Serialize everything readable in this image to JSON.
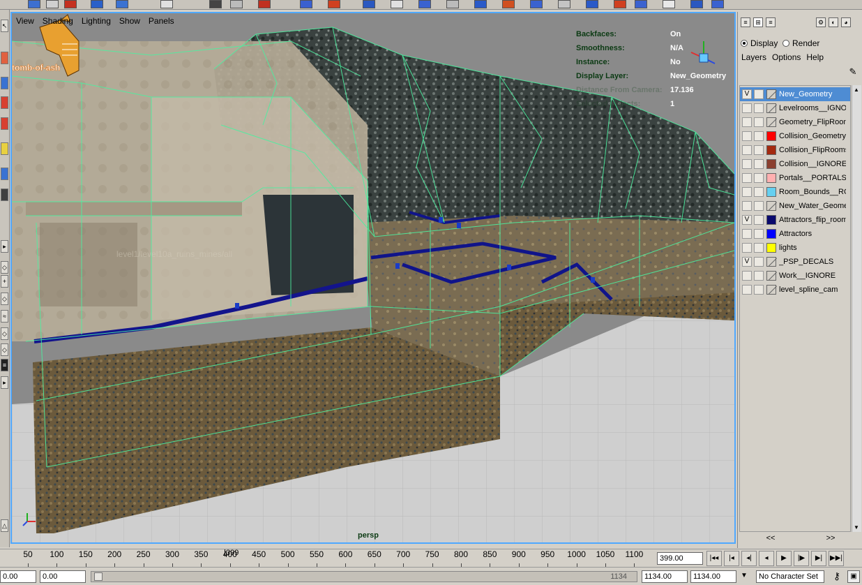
{
  "logo": {
    "text": "tomb-of-ash"
  },
  "viewport_menu": [
    "View",
    "Shading",
    "Lighting",
    "Show",
    "Panels"
  ],
  "hud": {
    "rows": [
      {
        "label": "Backfaces:",
        "value": "On"
      },
      {
        "label": "Smoothness:",
        "value": "N/A"
      },
      {
        "label": "Instance:",
        "value": "No"
      },
      {
        "label": "Display Layer:",
        "value": "New_Geometry"
      },
      {
        "label": "Distance From Camera:",
        "value": "17.136"
      },
      {
        "label": "Selected Objects:",
        "value": "1"
      }
    ],
    "overlay_text": "level1/level10a_ruins_mines/all",
    "camera": "persp"
  },
  "right_panel": {
    "radio_display": "Display",
    "radio_render": "Render",
    "radio_selected": "display",
    "menu": [
      "Layers",
      "Options",
      "Help"
    ],
    "layers": [
      {
        "v": "V",
        "p": "",
        "color": "",
        "name": "New_Geometry",
        "selected": true
      },
      {
        "v": "",
        "p": "",
        "color": "",
        "name": "Levelrooms__IGNORE"
      },
      {
        "v": "",
        "p": "",
        "color": "",
        "name": "Geometry_FlipRooms"
      },
      {
        "v": "",
        "p": "",
        "color": "#ff0000",
        "name": "Collision_Geometry"
      },
      {
        "v": "",
        "p": "",
        "color": "#a42a10",
        "name": "Collision_FlipRooms"
      },
      {
        "v": "",
        "p": "",
        "color": "#8b4030",
        "name": "Collision__IGNORE"
      },
      {
        "v": "",
        "p": "",
        "color": "#ffb0b0",
        "name": "Portals__PORTALS"
      },
      {
        "v": "",
        "p": "",
        "color": "#66d0f0",
        "name": "Room_Bounds__ROOMS"
      },
      {
        "v": "",
        "p": "",
        "color": "",
        "name": "New_Water_Geometry"
      },
      {
        "v": "V",
        "p": "",
        "color": "#0a0a6e",
        "name": "Attractors_flip_rooms"
      },
      {
        "v": "",
        "p": "",
        "color": "#0000ff",
        "name": "Attractors"
      },
      {
        "v": "",
        "p": "",
        "color": "#ffff00",
        "name": "lights"
      },
      {
        "v": "V",
        "p": "",
        "color": "",
        "name": "_PSP_DECALS"
      },
      {
        "v": "",
        "p": "",
        "color": "",
        "name": "Work__IGNORE"
      },
      {
        "v": "",
        "p": "",
        "color": "",
        "name": "level_spline_cam"
      }
    ],
    "scroll_left": "<<",
    "scroll_right": ">>"
  },
  "timeline": {
    "ticks": [
      "50",
      "100",
      "150",
      "200",
      "250",
      "300",
      "350",
      "400",
      "450",
      "500",
      "550",
      "600",
      "650",
      "700",
      "750",
      "800",
      "850",
      "900",
      "950",
      "1000",
      "1050",
      "1100"
    ],
    "current_frame_marker": "399",
    "current_frame": "399.00",
    "playback_buttons": [
      "|◂◂",
      "|◂",
      "◂|",
      "◂",
      "▶",
      "|▶",
      "▶|",
      "▶▶|"
    ]
  },
  "range": {
    "start_outer": "0.00",
    "start_inner": "0.00",
    "end_inner": "1134.00",
    "end_outer": "1134.00",
    "bar_end_label": "1134",
    "character_set": "No Character Set"
  }
}
